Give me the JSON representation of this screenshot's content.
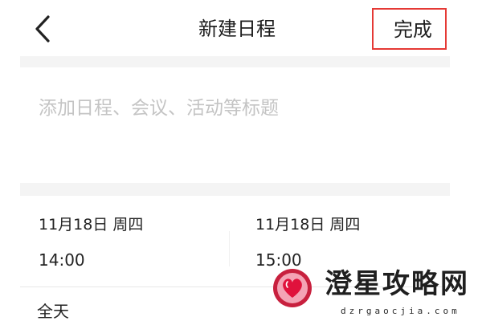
{
  "header": {
    "back_icon": "chevron-left-icon",
    "title": "新建日程",
    "done_label": "完成"
  },
  "title_input": {
    "value": "",
    "placeholder": "添加日程、会议、活动等标题"
  },
  "start": {
    "date": "11月18日 周四",
    "time": "14:00"
  },
  "end": {
    "date": "11月18日 周四",
    "time": "15:00"
  },
  "all_day": {
    "label": "全天"
  },
  "watermark": {
    "logo_icon": "heart-logo-icon",
    "name": "澄星攻略网",
    "url": "dzrgaocjia.com"
  },
  "colors": {
    "highlight": "#e53935",
    "text": "#222222",
    "placeholder": "#c4c4c4",
    "separator": "#f4f4f4"
  }
}
